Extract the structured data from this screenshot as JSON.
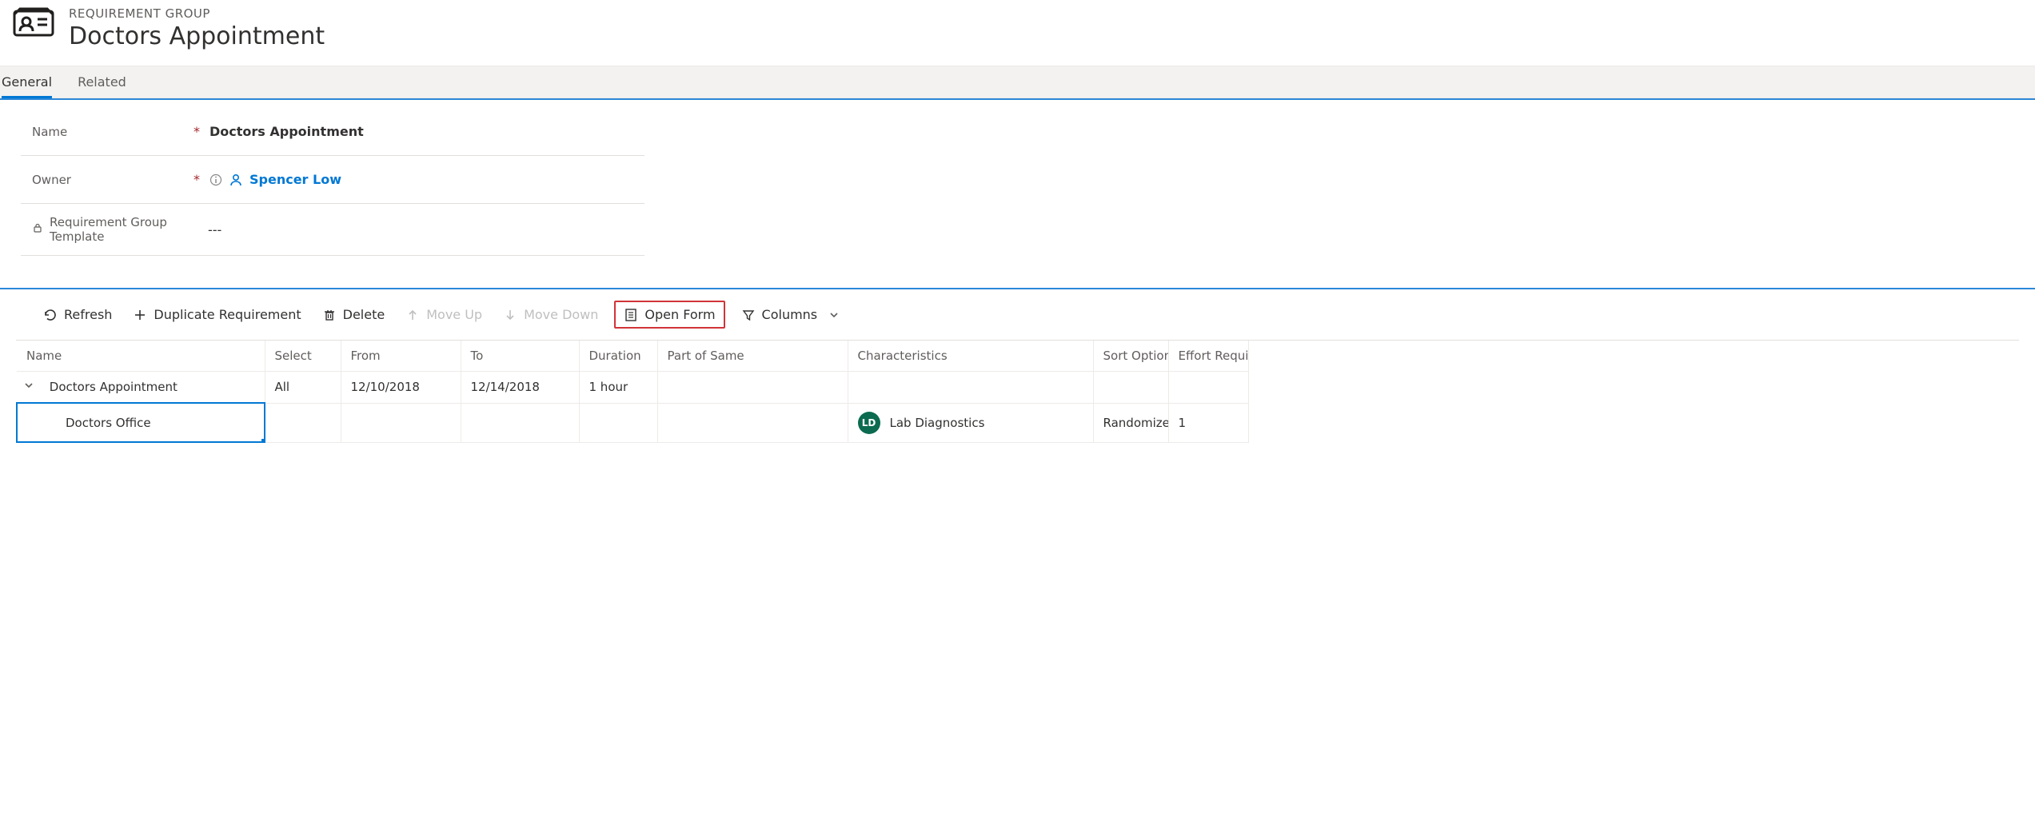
{
  "header": {
    "eyebrow": "REQUIREMENT GROUP",
    "title": "Doctors Appointment"
  },
  "tabs": {
    "general": "General",
    "related": "Related"
  },
  "form": {
    "name_label": "Name",
    "name_value": "Doctors Appointment",
    "owner_label": "Owner",
    "owner_value": "Spencer Low",
    "template_label": "Requirement Group Template",
    "template_value": "---"
  },
  "toolbar": {
    "refresh": "Refresh",
    "duplicate": "Duplicate Requirement",
    "delete": "Delete",
    "move_up": "Move Up",
    "move_down": "Move Down",
    "open_form": "Open Form",
    "columns": "Columns"
  },
  "grid": {
    "headers": {
      "name": "Name",
      "select": "Select",
      "from": "From",
      "to": "To",
      "duration": "Duration",
      "part_of_same": "Part of Same",
      "characteristics": "Characteristics",
      "sort_option": "Sort Option",
      "effort_required": "Effort Require"
    },
    "rows": [
      {
        "name": "Doctors Appointment",
        "select": "All",
        "from": "12/10/2018",
        "to": "12/14/2018",
        "duration": "1 hour",
        "part_of_same": "",
        "characteristics": "",
        "char_initials": "",
        "sort_option": "",
        "effort_required": ""
      },
      {
        "name": "Doctors Office",
        "select": "",
        "from": "",
        "to": "",
        "duration": "",
        "part_of_same": "",
        "characteristics": "Lab Diagnostics",
        "char_initials": "LD",
        "sort_option": "Randomize",
        "effort_required": "1"
      }
    ]
  }
}
